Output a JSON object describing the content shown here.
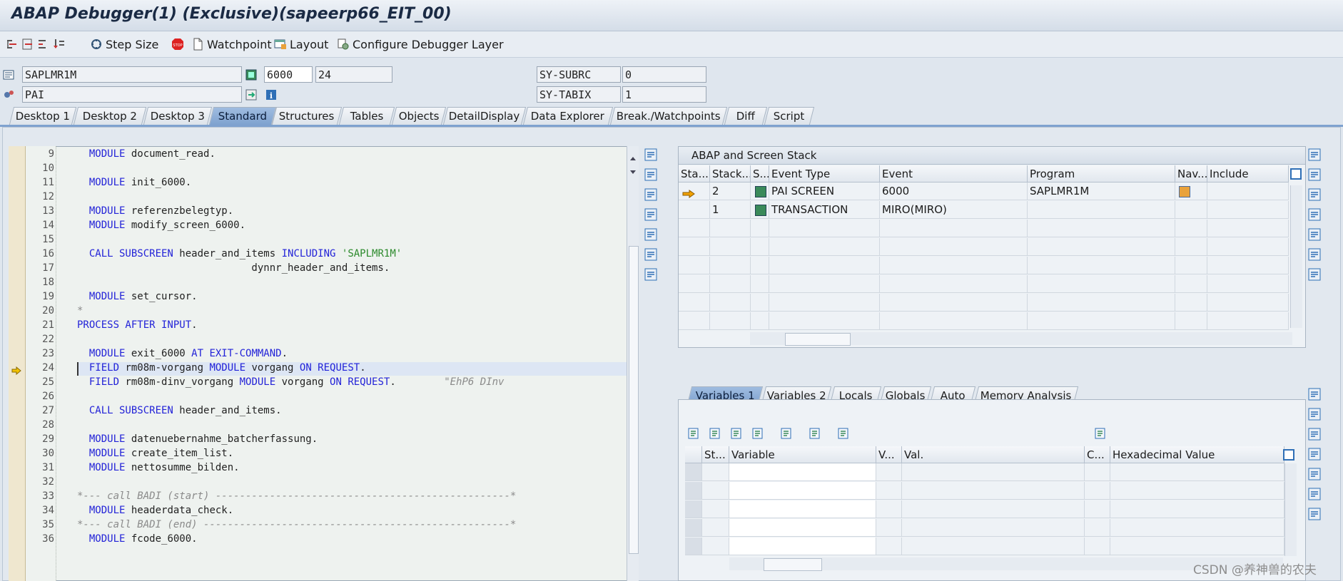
{
  "window": {
    "title": "ABAP Debugger(1)  (Exclusive)(sapeerp66_EIT_00)"
  },
  "toolbar": {
    "step_size_label": "Step Size",
    "watchpoint_label": "Watchpoint",
    "layout_label": "Layout",
    "configure_label": "Configure Debugger Layer"
  },
  "info": {
    "program": "SAPLMR1M",
    "event": "PAI",
    "screen": "6000",
    "separator": "/",
    "line": "24",
    "sysubrc_label": "SY-SUBRC",
    "sysubrc_value": "0",
    "sytabix_label": "SY-TABIX",
    "sytabix_value": "1"
  },
  "tabs": [
    "Desktop 1",
    "Desktop 2",
    "Desktop 3",
    "Standard",
    "Structures",
    "Tables",
    "Objects",
    "DetailDisplay",
    "Data Explorer",
    "Break./Watchpoints",
    "Diff",
    "Script"
  ],
  "active_tab": "Standard",
  "code": {
    "current_line": "24",
    "lines": [
      {
        "num": "9",
        "text": "  MODULE document_read."
      },
      {
        "num": "10",
        "text": ""
      },
      {
        "num": "11",
        "text": "  MODULE init_6000."
      },
      {
        "num": "12",
        "text": ""
      },
      {
        "num": "13",
        "text": "  MODULE referenzbelegtyp."
      },
      {
        "num": "14",
        "text": "  MODULE modify_screen_6000."
      },
      {
        "num": "15",
        "text": ""
      },
      {
        "num": "16",
        "text": "  CALL SUBSCREEN header_and_items INCLUDING 'SAPLMR1M'"
      },
      {
        "num": "17",
        "text": "                             dynnr_header_and_items."
      },
      {
        "num": "18",
        "text": ""
      },
      {
        "num": "19",
        "text": "  MODULE set_cursor."
      },
      {
        "num": "20",
        "text": "*"
      },
      {
        "num": "21",
        "text": "PROCESS AFTER INPUT."
      },
      {
        "num": "22",
        "text": ""
      },
      {
        "num": "23",
        "text": "  MODULE exit_6000 AT EXIT-COMMAND."
      },
      {
        "num": "24",
        "text": "  FIELD rm08m-vorgang MODULE vorgang ON REQUEST."
      },
      {
        "num": "25",
        "text": "  FIELD rm08m-dinv_vorgang MODULE vorgang ON REQUEST.        \"EhP6 DInv"
      },
      {
        "num": "26",
        "text": ""
      },
      {
        "num": "27",
        "text": "  CALL SUBSCREEN header_and_items."
      },
      {
        "num": "28",
        "text": ""
      },
      {
        "num": "29",
        "text": "  MODULE datenuebernahme_batcherfassung."
      },
      {
        "num": "30",
        "text": "  MODULE create_item_list."
      },
      {
        "num": "31",
        "text": "  MODULE nettosumme_bilden."
      },
      {
        "num": "32",
        "text": ""
      },
      {
        "num": "33",
        "text": "*--- call BADI (start) -------------------------------------------------*"
      },
      {
        "num": "34",
        "text": "  MODULE headerdata_check."
      },
      {
        "num": "35",
        "text": "*--- call BADI (end) ---------------------------------------------------*"
      },
      {
        "num": "36",
        "text": "  MODULE fcode_6000."
      }
    ]
  },
  "stack": {
    "title": "ABAP and Screen Stack",
    "columns": [
      "Sta...",
      "Stack...",
      "S...",
      "Event Type",
      "Event",
      "Program",
      "Nav...",
      "Include"
    ],
    "rows": [
      {
        "level": "2",
        "event_type": "PAI SCREEN",
        "event": "6000",
        "program": "SAPLMR1M",
        "current": true
      },
      {
        "level": "1",
        "event_type": "TRANSACTION",
        "event": "MIRO(MIRO)",
        "program": "",
        "current": false
      }
    ]
  },
  "vars": {
    "tabs": [
      "Variables 1",
      "Variables 2",
      "Locals",
      "Globals",
      "Auto",
      "Memory Analysis"
    ],
    "active_tab": "Variables 1",
    "columns": [
      "St...",
      "Variable",
      "V...",
      "Val.",
      "C...",
      "Hexadecimal Value"
    ]
  },
  "watermark": "CSDN @养神兽的农夫",
  "colors": {
    "keyword": "#2323d8",
    "string": "#2c8a2c",
    "comment": "#8a8a8a",
    "active_tab": "#7fa2cf"
  }
}
